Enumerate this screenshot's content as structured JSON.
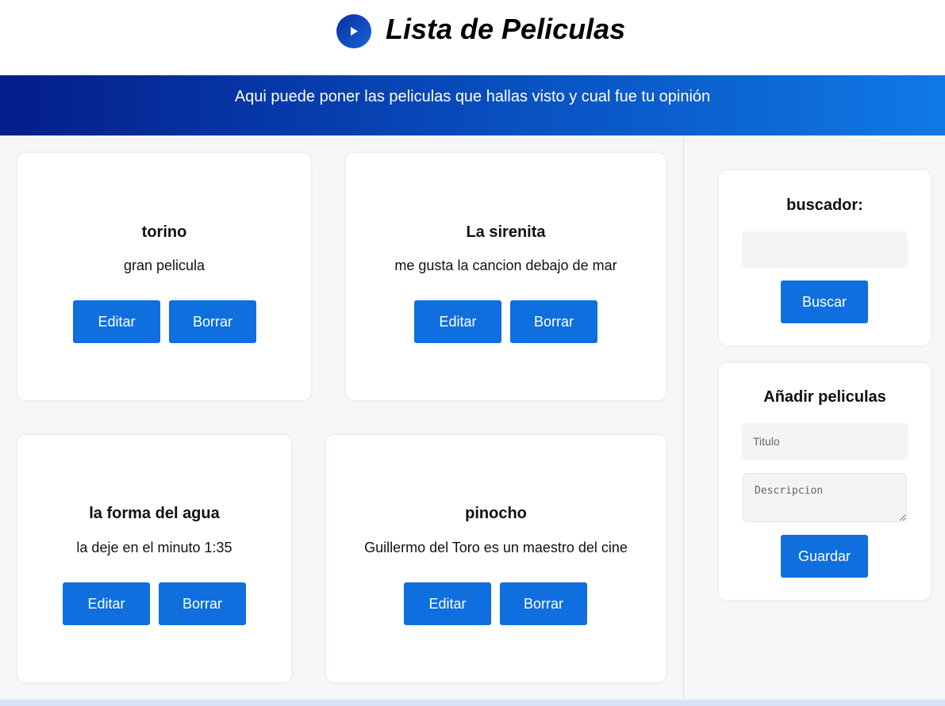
{
  "header": {
    "title": "Lista de Peliculas",
    "logo_icon": "play-icon",
    "banner_text": "Aqui puede poner las peliculas que hallas visto y cual fue tu opinión"
  },
  "movies": [
    {
      "title": "torino",
      "description": "gran pelicula",
      "edit_label": "Editar",
      "delete_label": "Borrar"
    },
    {
      "title": "La sirenita",
      "description": "me gusta la cancion debajo de mar",
      "edit_label": "Editar",
      "delete_label": "Borrar"
    },
    {
      "title": "la forma del agua",
      "description": "la deje en el minuto 1:35",
      "edit_label": "Editar",
      "delete_label": "Borrar"
    },
    {
      "title": "pinocho",
      "description": "Guillermo del Toro es un maestro del cine",
      "edit_label": "Editar",
      "delete_label": "Borrar"
    }
  ],
  "search": {
    "heading": "buscador:",
    "value": "",
    "placeholder": "",
    "button_label": "Buscar"
  },
  "add": {
    "heading": "Añadir peliculas",
    "title_placeholder": "Titulo",
    "description_placeholder": "Descripcion",
    "save_label": "Guardar"
  },
  "colors": {
    "accent": "#0f6fde",
    "banner_start": "#041d8a",
    "banner_end": "#0f79e6"
  }
}
